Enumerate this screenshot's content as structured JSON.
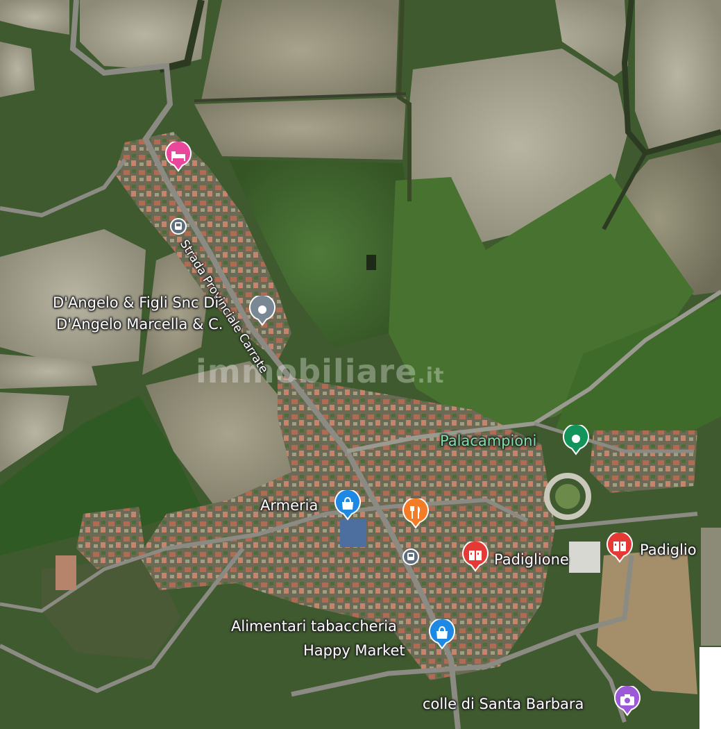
{
  "map": {
    "watermark": {
      "main": "immobiliare",
      "suffix": ".it"
    },
    "road_label": "Strada Provinciale Carrate",
    "places": [
      {
        "id": "lodging",
        "label": "",
        "icon": "bed-icon",
        "color": "#e8479b"
      },
      {
        "id": "dangelo",
        "label_line1": "D'Angelo & Figli Snc Di",
        "label_line2": "D'Angelo Marcella & C.",
        "icon": "dot-icon",
        "color": "#7a8794"
      },
      {
        "id": "palacampioni",
        "label": "Palacampioni",
        "icon": "dot-icon",
        "color": "#13945a"
      },
      {
        "id": "armeria",
        "label": "Armeria",
        "icon": "shopping-bag-icon",
        "color": "#1e88e5"
      },
      {
        "id": "restaurant",
        "label": "",
        "icon": "fork-knife-icon",
        "color": "#f47c26"
      },
      {
        "id": "padiglione-1",
        "label": "Padiglione",
        "icon": "building-icon",
        "color": "#e53935"
      },
      {
        "id": "padiglione-2",
        "label": "Padiglio",
        "icon": "building-icon",
        "color": "#e53935"
      },
      {
        "id": "alimentari",
        "label_line1": "Alimentari tabaccheria",
        "label_line2": "Happy Market",
        "icon": "shopping-bag-icon",
        "color": "#1e88e5"
      },
      {
        "id": "colle",
        "label": "colle di Santa Barbara",
        "icon": "camera-icon",
        "color": "#9c5ad6"
      }
    ],
    "bus_stops": [
      {
        "id": "bus-stop-north",
        "icon": "bus-icon"
      },
      {
        "id": "bus-stop-south",
        "icon": "bus-icon"
      }
    ]
  }
}
